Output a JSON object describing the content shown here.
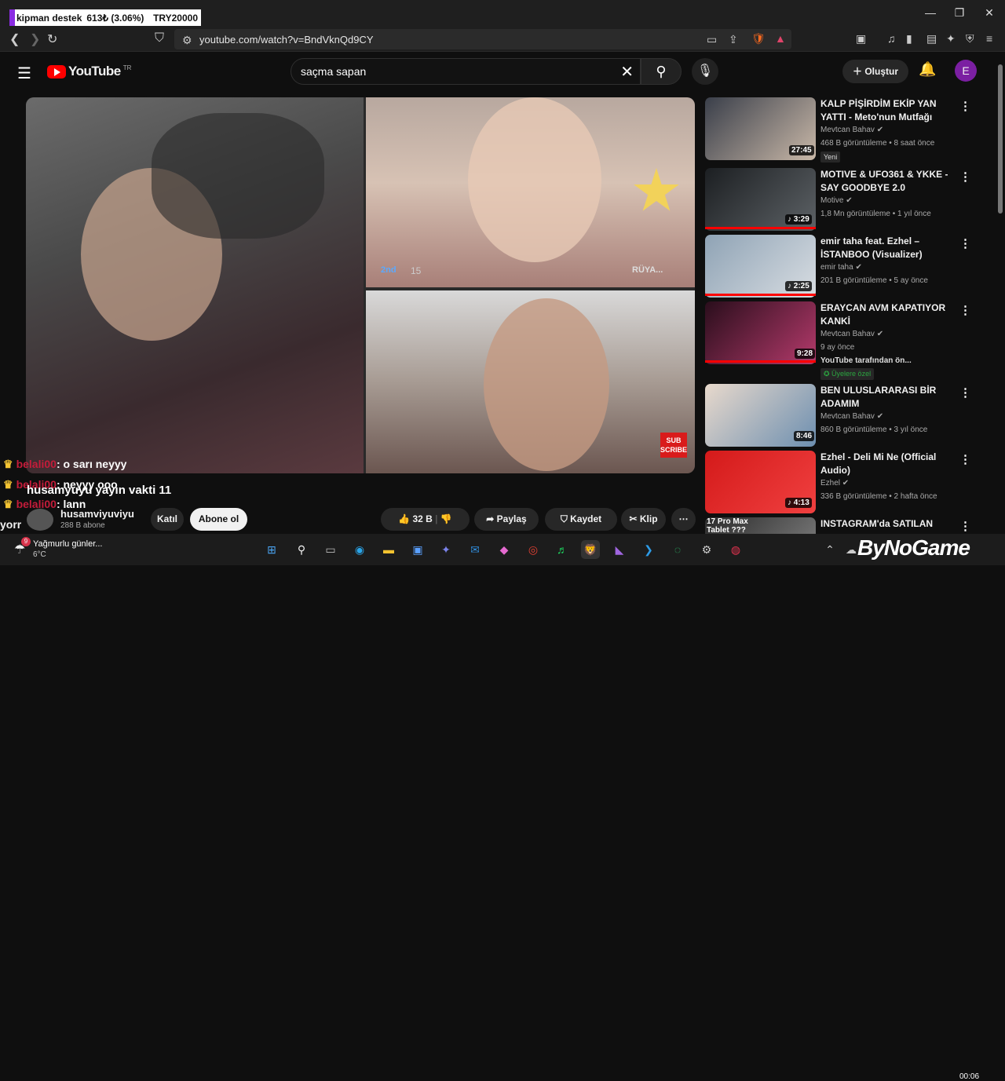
{
  "stream_overlay": {
    "donation_label": "kipman destek",
    "donation_amount": "613₺ (3.06%)",
    "donation_goal": "TRY20000"
  },
  "window_controls": {
    "minimize": "—",
    "maximize": "❐",
    "close": "✕"
  },
  "browser": {
    "url": "youtube.com/watch?v=BndVknQd9CY",
    "ext_count": "11"
  },
  "header": {
    "logo_word": "YouTube",
    "logo_region": "TR",
    "search_value": "saçma sapan",
    "create_label": "Oluştur",
    "avatar_letter": "E"
  },
  "player": {
    "badge_rank": "2nd",
    "badge_count": "15",
    "ruya_label": "RÜYA...",
    "subscribe_logo_line1": "SUB",
    "subscribe_logo_line2": "SCRIBE"
  },
  "chat": [
    {
      "user": "belali00",
      "msg": ": o sarı neyyy"
    },
    {
      "user": "belali00",
      "msg": ": neyyy ooo"
    },
    {
      "user": "belali00",
      "msg": ": lann"
    }
  ],
  "chat_big_message": "husamyuyu yayın vakti 11",
  "channel": {
    "name": "husamviyuviyu",
    "subs": "288 B abone",
    "cut_text": "yorr"
  },
  "actions": {
    "join": "Katıl",
    "subscribe": "Abone ol",
    "likes": "32 B",
    "share": "Paylaş",
    "save": "Kaydet",
    "clip": "Klip",
    "more": "⋯"
  },
  "recommendations": [
    {
      "title": "KALP PİŞİRDİM EKİP YAN YATTI - Meto'nun Mutfağı",
      "channel": "Mevtcan Bahav",
      "meta": "468 B görüntüleme • 8 saat önce",
      "duration": "27:45",
      "tag": "Yeni",
      "thumb_colors": [
        "#3a3f4a",
        "#c9b8a8"
      ]
    },
    {
      "title": "MOTIVE & UFO361 & YKKE - SAY GOODBYE 2.0",
      "channel": "Motive",
      "meta": "1,8 Mn görüntüleme • 1 yıl önce",
      "duration": "3:29",
      "thumb_colors": [
        "#1c1f22",
        "#5d6266"
      ]
    },
    {
      "title": "emir taha feat. Ezhel – İSTANBOO (Visualizer)",
      "channel": "emir taha",
      "meta": "201 B görüntüleme • 5 ay önce",
      "duration": "2:25",
      "thumb_colors": [
        "#8fa3b5",
        "#d8dde2"
      ]
    },
    {
      "title": "ERAYCAN AVM KAPATIYOR KANKİ",
      "channel": "Mevtcan Bahav",
      "meta": "9 ay önce",
      "meta2": "YouTube tarafından ön...",
      "duration": "9:28",
      "tag": "Üyelere özel",
      "thumb_colors": [
        "#2a0e1c",
        "#b43a6b"
      ]
    },
    {
      "title": "BEN ULUSLARARASI BİR ADAMIM",
      "channel": "Mevtcan Bahav",
      "meta": "860 B görüntüleme • 3 yıl önce",
      "duration": "8:46",
      "thumb_colors": [
        "#e8d9cc",
        "#6d8fb0"
      ]
    },
    {
      "title": "Ezhel - Deli Mi Ne (Official Audio)",
      "channel": "Ezhel",
      "meta": "336 B görüntüleme • 2 hafta önce",
      "duration": "4:13",
      "thumb_colors": [
        "#d41a1a",
        "#f04040"
      ]
    },
    {
      "title": "INSTAGRAM'da SATILAN",
      "thumb_caption": "17 Pro Max Tablet ???",
      "thumb_colors": [
        "#2b2b2b",
        "#8a8a8a"
      ]
    }
  ],
  "taskbar": {
    "weather": "Yağmurlu günler...",
    "temp": "6°C",
    "weather_badge": "9",
    "watermark": "ByNoGame",
    "clock": "00:06"
  }
}
